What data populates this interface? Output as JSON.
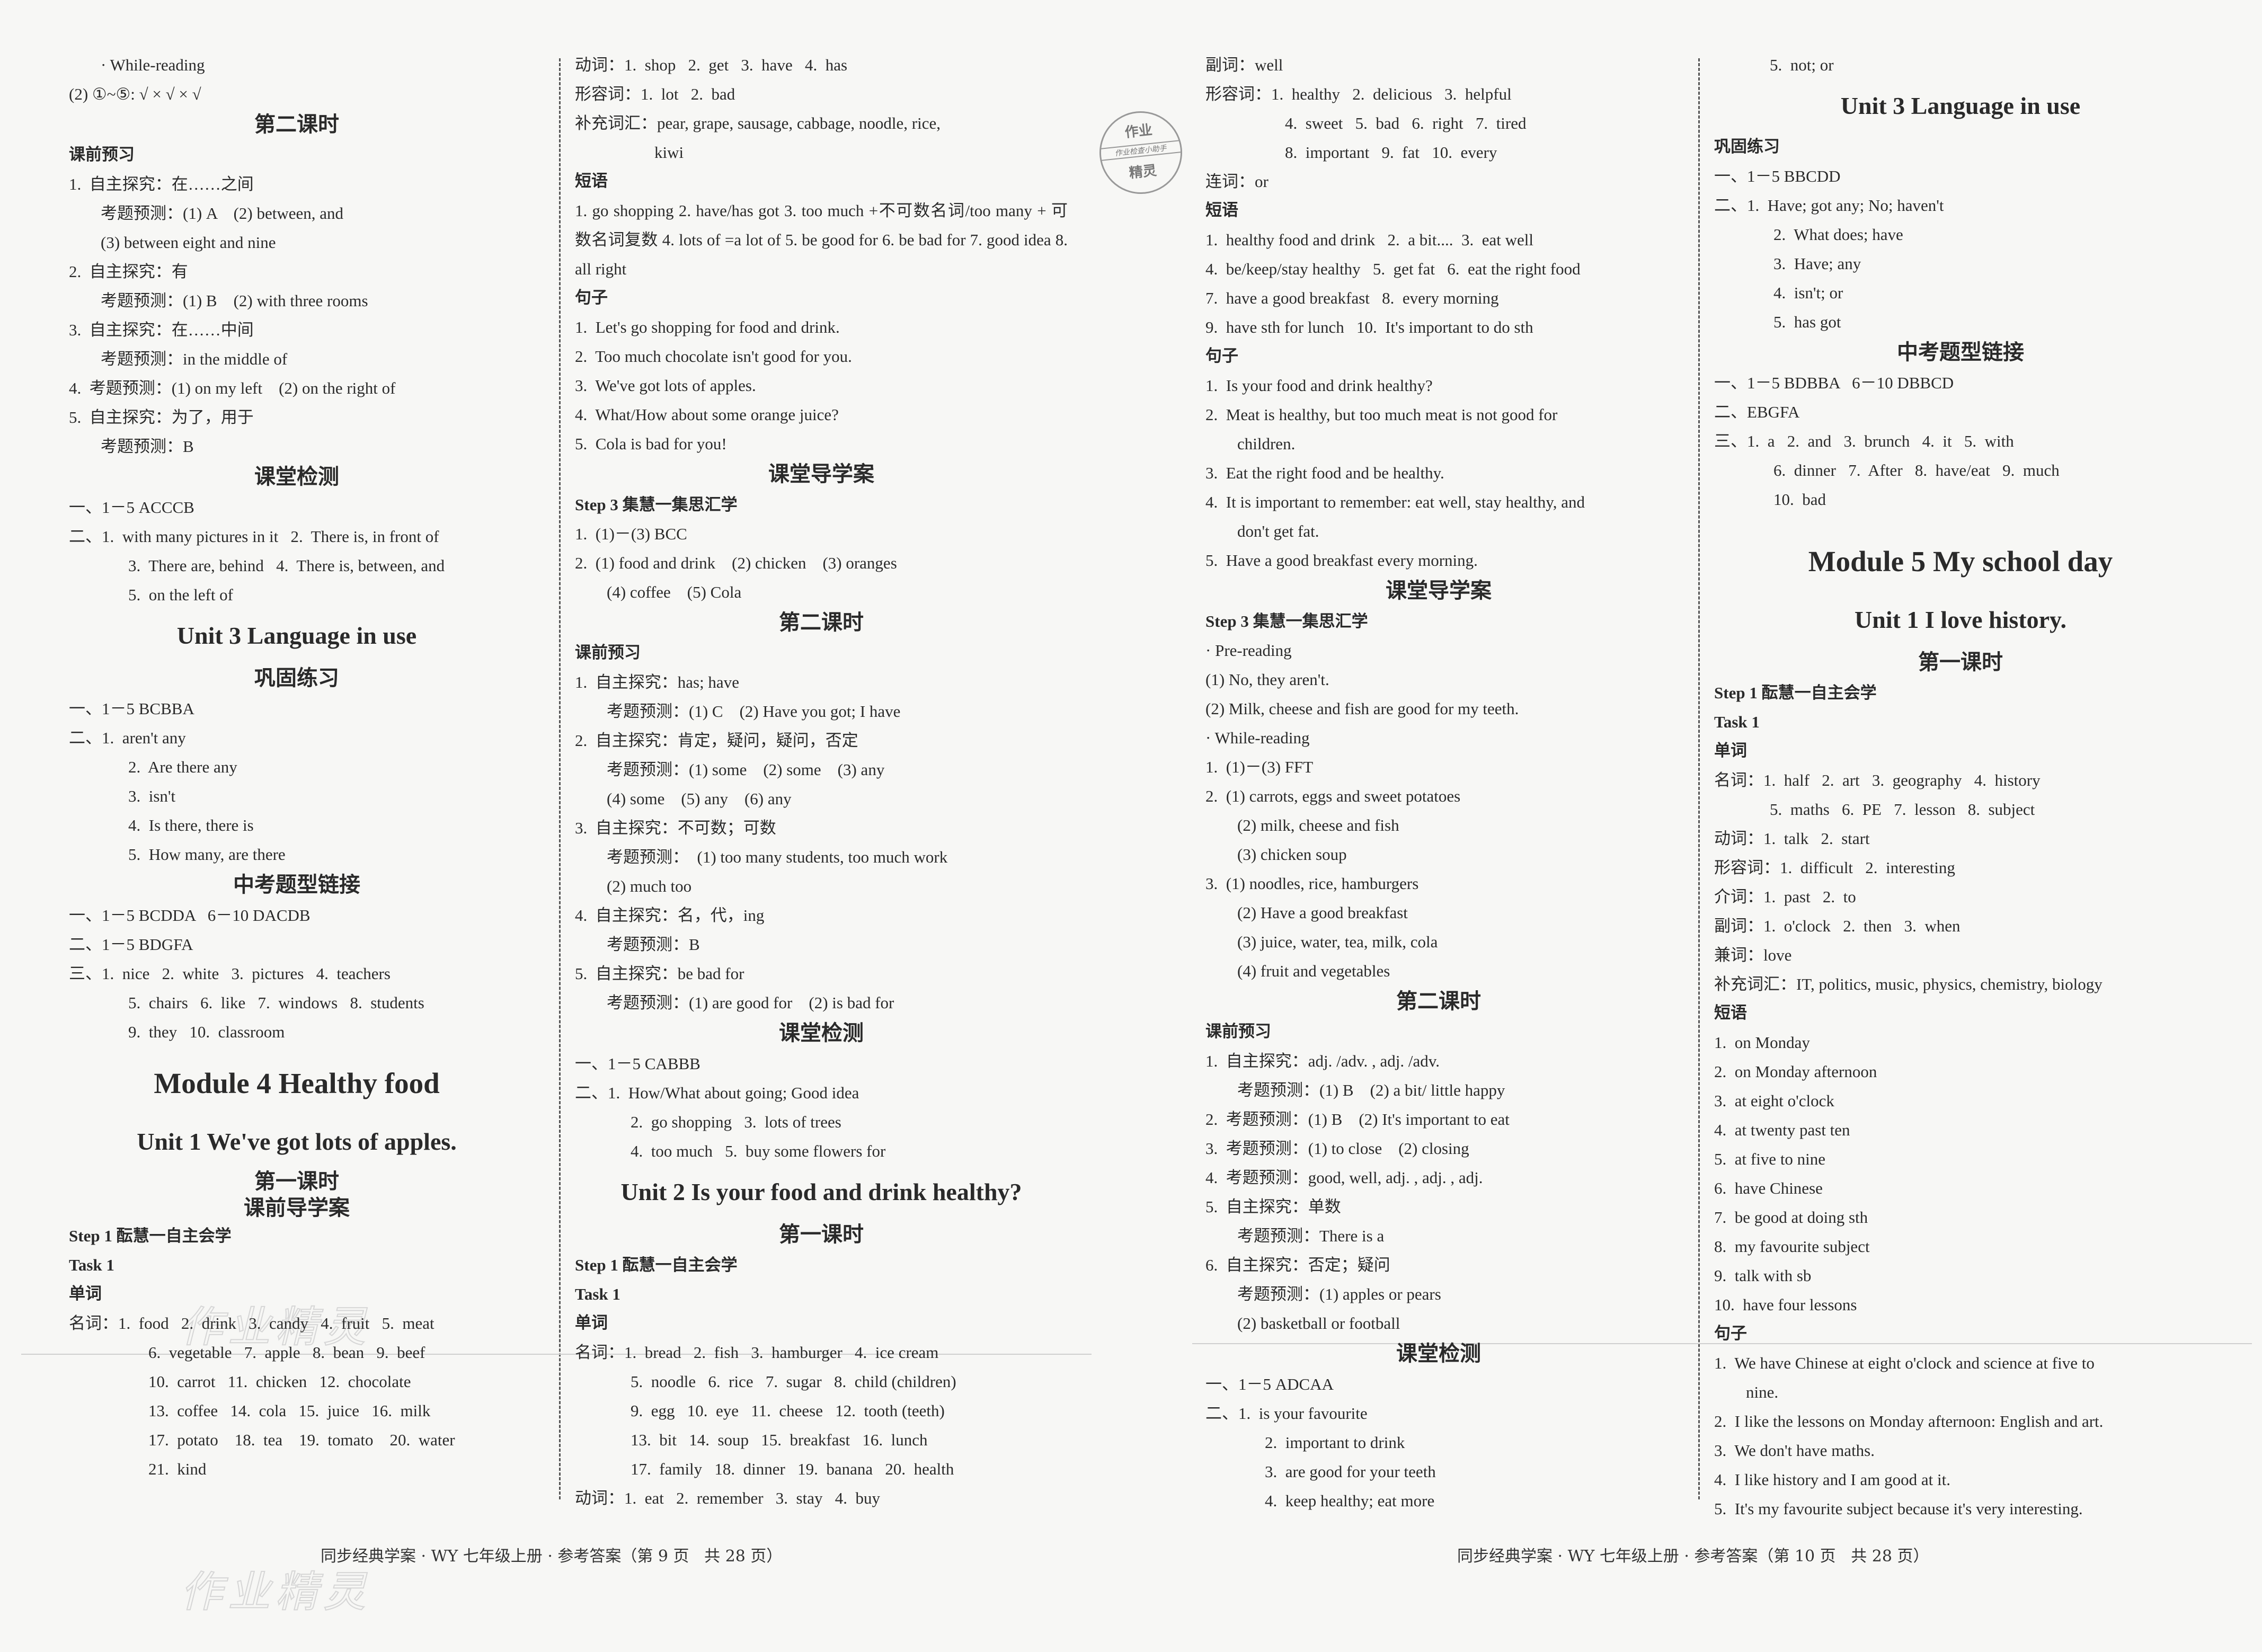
{
  "col1": {
    "lines": [
      "· While-reading",
      "(2) ①~⑤: √ × √ × √"
    ],
    "lesson2_title": "第二课时",
    "preview_title": "课前预习",
    "preview": [
      {
        "t": "1.  自主探究：在……之间",
        "c": ""
      },
      {
        "t": "考题预测：(1) A    (2) between, and",
        "c": "ind1"
      },
      {
        "t": "(3) between eight and nine",
        "c": "ind1"
      },
      {
        "t": "2.  自主探究：有",
        "c": ""
      },
      {
        "t": "考题预测：(1) B    (2) with three rooms",
        "c": "ind1"
      },
      {
        "t": "3.  自主探究：在……中间",
        "c": ""
      },
      {
        "t": "考题预测：in the middle of",
        "c": "ind1"
      },
      {
        "t": "4.  考题预测：(1) on my left    (2) on the right of",
        "c": ""
      },
      {
        "t": "5.  自主探究：为了，用于",
        "c": ""
      },
      {
        "t": "考题预测：B",
        "c": "ind1"
      }
    ],
    "check_title": "课堂检测",
    "check": [
      {
        "t": "一、1－5 ACCCB",
        "c": ""
      },
      {
        "t": "二、1.  with many pictures in it   2.  There is, in front of",
        "c": ""
      },
      {
        "t": "3.  There are, behind   4.  There is, between, and",
        "c": "ind-xl"
      },
      {
        "t": "5.  on the left of",
        "c": "ind-xl"
      }
    ],
    "unit3_title": "Unit 3    Language in use",
    "consolidate_title": "巩固练习",
    "consolidate": [
      {
        "t": "一、1－5 BCBBA",
        "c": ""
      },
      {
        "t": "二、1.  aren't any",
        "c": ""
      },
      {
        "t": "2.  Are there any",
        "c": "ind-xl"
      },
      {
        "t": "3.  isn't",
        "c": "ind-xl"
      },
      {
        "t": "4.  Is there, there is",
        "c": "ind-xl"
      },
      {
        "t": "5.  How many, are there",
        "c": "ind-xl"
      }
    ],
    "exam_title": "中考题型链接",
    "exam": [
      {
        "t": "一、1－5 BCDDA   6－10 DACDB",
        "c": ""
      },
      {
        "t": "二、1－5 BDGFA",
        "c": ""
      },
      {
        "t": "三、1.  nice   2.  white   3.  pictures   4.  teachers",
        "c": ""
      },
      {
        "t": "5.  chairs   6.  like   7.  windows   8.  students",
        "c": "ind-xl"
      },
      {
        "t": "9.  they   10.  classroom",
        "c": "ind-xl"
      }
    ],
    "module4_title": "Module 4    Healthy food",
    "unit1_title": "Unit 1    We've got lots of apples.",
    "lesson1_title": "第一课时",
    "preclass_title": "课前导学案",
    "step1": "Step 1    酝慧一自主会学",
    "task1": "Task 1",
    "words_title": "单词",
    "nouns": [
      {
        "t": "名词：1.  food   2.  drink   3.  candy   4.  fruit   5.  meat",
        "c": ""
      },
      {
        "t": "6.  vegetable   7.  apple   8.  bean   9.  beef",
        "c": "ind3"
      },
      {
        "t": "10.  carrot   11.  chicken   12.  chocolate",
        "c": "ind3"
      },
      {
        "t": "13.  coffee   14.  cola   15.  juice   16.  milk",
        "c": "ind3"
      },
      {
        "t": "17.  potato    18.  tea    19.  tomato    20.  water",
        "c": "ind3"
      },
      {
        "t": "21.  kind",
        "c": "ind3"
      }
    ]
  },
  "col2": {
    "top": [
      {
        "t": "动词：1.  shop   2.  get   3.  have   4.  has",
        "c": ""
      },
      {
        "t": "形容词：1.  lot   2.  bad",
        "c": ""
      },
      {
        "t": "补充词汇：pear, grape, sausage, cabbage, noodle, rice,",
        "c": ""
      },
      {
        "t": "kiwi",
        "c": "ind3"
      }
    ],
    "phrases_title": "短语",
    "phrases_text": "1.  go shopping   2.  have/has got   3.  too much +不可数名词/too many + 可数名词复数   4.  lots of =a lot of   5.  be good for   6.  be bad for   7.  good idea   8.  all right",
    "sentences_title": "句子",
    "sentences": [
      "1.  Let's go shopping for food and drink.",
      "2.  Too much chocolate isn't good for you.",
      "3.  We've got lots of apples.",
      "4.  What/How about some orange juice?",
      "5.  Cola is bad for you!"
    ],
    "guide_title": "课堂导学案",
    "step3": "Step 3    集慧一集思汇学",
    "step3_items": [
      {
        "t": "1.  (1)－(3) BCC",
        "c": ""
      },
      {
        "t": "2.  (1) food and drink    (2) chicken    (3) oranges",
        "c": ""
      },
      {
        "t": "(4) coffee    (5) Cola",
        "c": "ind1"
      }
    ],
    "lesson2_title": "第二课时",
    "preview_title": "课前预习",
    "preview": [
      {
        "t": "1.  自主探究：has; have",
        "c": ""
      },
      {
        "t": "考题预测：(1) C    (2) Have you got; I have",
        "c": "ind1"
      },
      {
        "t": "2.  自主探究：肯定，疑问，疑问，否定",
        "c": ""
      },
      {
        "t": "考题预测：(1) some    (2) some    (3) any",
        "c": "ind1"
      },
      {
        "t": "(4) some    (5) any    (6) any",
        "c": "ind1"
      },
      {
        "t": "3.  自主探究：不可数；可数",
        "c": ""
      },
      {
        "t": "考题预测：  (1) too many students, too much work",
        "c": "ind1"
      },
      {
        "t": "(2) much too",
        "c": "ind1"
      },
      {
        "t": "4.  自主探究：名，代，ing",
        "c": ""
      },
      {
        "t": "考题预测：B",
        "c": "ind1"
      },
      {
        "t": "5.  自主探究：be bad for",
        "c": ""
      },
      {
        "t": "考题预测：(1) are good for    (2) is bad for",
        "c": "ind1"
      }
    ],
    "check_title": "课堂检测",
    "check": [
      {
        "t": "一、1－5 CABBB",
        "c": ""
      },
      {
        "t": "二、1.  How/What about going; Good idea",
        "c": ""
      },
      {
        "t": "2.  go shopping   3.  lots of trees",
        "c": "ind2"
      },
      {
        "t": "4.  too much   5.  buy some flowers for",
        "c": "ind2"
      }
    ],
    "unit2_title": "Unit 2    Is your food and drink healthy?",
    "lesson1_title": "第一课时",
    "step1": "Step 1    酝慧一自主会学",
    "task1": "Task 1",
    "words_title": "单词",
    "nouns": [
      {
        "t": "名词：1.  bread   2.  fish   3.  hamburger   4.  ice cream",
        "c": ""
      },
      {
        "t": "5.  noodle   6.  rice   7.  sugar   8.  child (children)",
        "c": "ind2"
      },
      {
        "t": "9.  egg   10.  eye   11.  cheese   12.  tooth (teeth)",
        "c": "ind2"
      },
      {
        "t": "13.  bit   14.  soup   15.  breakfast   16.  lunch",
        "c": "ind2"
      },
      {
        "t": "17.  family   18.  dinner   19.  banana   20.  health",
        "c": "ind2"
      },
      {
        "t": "动词：1.  eat   2.  remember   3.  stay   4.  buy",
        "c": ""
      }
    ]
  },
  "col3": {
    "top": [
      {
        "t": "副词：well",
        "c": ""
      },
      {
        "t": "形容词：1.  healthy   2.  delicious   3.  helpful",
        "c": ""
      },
      {
        "t": "4.  sweet   5.  bad   6.  right   7.  tired",
        "c": "ind3"
      },
      {
        "t": "8.  important   9.  fat   10.  every",
        "c": "ind3"
      },
      {
        "t": "连词：or",
        "c": ""
      }
    ],
    "phrases_title": "短语",
    "phrases": [
      "1.  healthy food and drink   2.  a bit....  3.  eat well",
      "4.  be/keep/stay healthy   5.  get fat   6.  eat the right food",
      "7.  have a good breakfast   8.  every morning",
      "9.  have sth for lunch   10.  It's important to do sth"
    ],
    "sentences_title": "句子",
    "sentences": [
      {
        "t": "1.  Is your food and drink healthy?",
        "c": ""
      },
      {
        "t": "2.  Meat is healthy, but too much meat is not good for",
        "c": ""
      },
      {
        "t": "children.",
        "c": "ind1"
      },
      {
        "t": "3.  Eat the right food and be healthy.",
        "c": ""
      },
      {
        "t": "4.  It is important to remember: eat well, stay healthy, and",
        "c": ""
      },
      {
        "t": "don't get fat.",
        "c": "ind1"
      },
      {
        "t": "5.  Have a good breakfast every morning.",
        "c": ""
      }
    ],
    "guide_title": "课堂导学案",
    "step3": "Step 3    集慧一集思汇学",
    "step3_items": [
      {
        "t": "· Pre-reading",
        "c": ""
      },
      {
        "t": "(1) No, they aren't.",
        "c": ""
      },
      {
        "t": "(2) Milk, cheese and fish are good for my teeth.",
        "c": ""
      },
      {
        "t": "· While-reading",
        "c": ""
      },
      {
        "t": "1.  (1)－(3) FFT",
        "c": ""
      },
      {
        "t": "2.  (1) carrots, eggs and sweet potatoes",
        "c": ""
      },
      {
        "t": "(2) milk, cheese and fish",
        "c": "ind1"
      },
      {
        "t": "(3) chicken soup",
        "c": "ind1"
      },
      {
        "t": "3.  (1) noodles, rice, hamburgers",
        "c": ""
      },
      {
        "t": "(2) Have a good breakfast",
        "c": "ind1"
      },
      {
        "t": "(3) juice, water, tea, milk, cola",
        "c": "ind1"
      },
      {
        "t": "(4) fruit and vegetables",
        "c": "ind1"
      }
    ],
    "lesson2_title": "第二课时",
    "preview_title": "课前预习",
    "preview": [
      {
        "t": "1.  自主探究：adj. /adv. , adj. /adv.",
        "c": ""
      },
      {
        "t": "考题预测：(1) B    (2) a bit/ little happy",
        "c": "ind1"
      },
      {
        "t": "2.  考题预测：(1) B    (2) It's important to eat",
        "c": ""
      },
      {
        "t": "3.  考题预测：(1) to close    (2) closing",
        "c": ""
      },
      {
        "t": "4.  考题预测：good, well, adj. , adj. , adj.",
        "c": ""
      },
      {
        "t": "5.  自主探究：单数",
        "c": ""
      },
      {
        "t": "考题预测：There is a",
        "c": "ind1"
      },
      {
        "t": "6.  自主探究：否定；疑问",
        "c": ""
      },
      {
        "t": "考题预测：(1) apples or pears",
        "c": "ind1"
      },
      {
        "t": "(2) basketball or football",
        "c": "ind1"
      }
    ],
    "check_title": "课堂检测",
    "check": [
      {
        "t": "一、1－5 ADCAA",
        "c": ""
      },
      {
        "t": "二、1.  is your favourite",
        "c": ""
      },
      {
        "t": "2.  important to drink",
        "c": "ind-xl"
      },
      {
        "t": "3.  are good for your teeth",
        "c": "ind-xl"
      },
      {
        "t": "4.  keep healthy; eat more",
        "c": "ind-xl"
      }
    ],
    "stamp": {
      "top": "作业",
      "middle": "作业检查小助手",
      "bottom": "精灵"
    }
  },
  "col4": {
    "top": [
      {
        "t": "5.  not; or",
        "c": "ind2"
      }
    ],
    "unit3_title": "Unit 3    Language in use",
    "consolidate_title": "巩固练习",
    "consolidate": [
      {
        "t": "一、1－5 BBCDD",
        "c": ""
      },
      {
        "t": "二、1.  Have; got any; No; haven't",
        "c": ""
      },
      {
        "t": "2.  What does; have",
        "c": "ind-xl"
      },
      {
        "t": "3.  Have; any",
        "c": "ind-xl"
      },
      {
        "t": "4.  isn't; or",
        "c": "ind-xl"
      },
      {
        "t": "5.  has got",
        "c": "ind-xl"
      }
    ],
    "exam_title": "中考题型链接",
    "exam": [
      {
        "t": "一、1－5 BDBBA   6－10 DBBCD",
        "c": ""
      },
      {
        "t": "二、EBGFA",
        "c": ""
      },
      {
        "t": "三、1.  a   2.  and   3.  brunch   4.  it   5.  with",
        "c": ""
      },
      {
        "t": "6.  dinner   7.  After   8.  have/eat   9.  much",
        "c": "ind-xl"
      },
      {
        "t": "10.  bad",
        "c": "ind-xl"
      }
    ],
    "module5_title": "Module 5    My school day",
    "unit1_title": "Unit 1    I love history.",
    "lesson1_title": "第一课时",
    "step1": "Step 1    酝慧一自主会学",
    "task1": "Task 1",
    "words_title": "单词",
    "words": [
      {
        "t": "名词：1.  half   2.  art   3.  geography   4.  history",
        "c": ""
      },
      {
        "t": "5.  maths   6.  PE   7.  lesson   8.  subject",
        "c": "ind2"
      },
      {
        "t": "动词：1.  talk   2.  start",
        "c": ""
      },
      {
        "t": "形容词：1.  difficult   2.  interesting",
        "c": ""
      },
      {
        "t": "介词：1.  past   2.  to",
        "c": ""
      },
      {
        "t": "副词：1.  o'clock   2.  then   3.  when",
        "c": ""
      },
      {
        "t": "兼词：love",
        "c": ""
      },
      {
        "t": "补充词汇：IT, politics, music, physics, chemistry, biology",
        "c": ""
      }
    ],
    "phrases_title": "短语",
    "phrases": [
      "1.  on Monday",
      "2.  on Monday afternoon",
      "3.  at eight o'clock",
      "4.  at twenty past ten",
      "5.  at five to nine",
      "6.  have Chinese",
      "7.  be good at doing sth",
      "8.  my favourite subject",
      "9.  talk with sb",
      "10.  have four lessons"
    ],
    "sentences_title": "句子",
    "sentences": [
      {
        "t": "1.  We have Chinese at eight o'clock and science at five to",
        "c": ""
      },
      {
        "t": "nine.",
        "c": "ind1"
      },
      {
        "t": "2.  I like the lessons on Monday afternoon: English and art.",
        "c": ""
      },
      {
        "t": "3.  We don't have maths.",
        "c": ""
      },
      {
        "t": "4.  I like history and I am good at it.",
        "c": ""
      },
      {
        "t": "5.  It's my favourite subject because it's very interesting.",
        "c": ""
      }
    ]
  },
  "footer": {
    "left": "同步经典学案 · WY 七年级上册 · 参考答案（第 9 页   共 28 页）",
    "right": "同步经典学案 · WY 七年级上册 · 参考答案（第 10 页   共 28 页）"
  },
  "watermark": "作业精灵"
}
